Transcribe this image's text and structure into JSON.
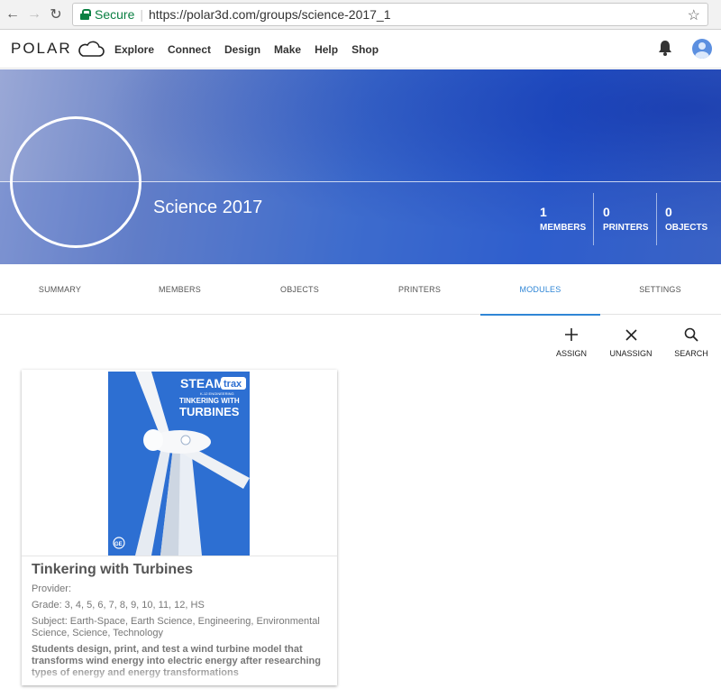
{
  "browser": {
    "secure_label": "Secure",
    "url": "https://polar3d.com/groups/science-2017_1"
  },
  "app": {
    "logo_text": "POLAR",
    "menu": [
      "Explore",
      "Connect",
      "Design",
      "Make",
      "Help",
      "Shop"
    ]
  },
  "group": {
    "title": "Science 2017",
    "stats": [
      {
        "value": "1",
        "label": "MEMBERS"
      },
      {
        "value": "0",
        "label": "PRINTERS"
      },
      {
        "value": "0",
        "label": "OBJECTS"
      }
    ]
  },
  "tabs": [
    "SUMMARY",
    "MEMBERS",
    "OBJECTS",
    "PRINTERS",
    "MODULES",
    "SETTINGS"
  ],
  "active_tab": "MODULES",
  "actions": {
    "assign": "ASSIGN",
    "unassign": "UNASSIGN",
    "search": "SEARCH"
  },
  "module": {
    "title": "Tinkering with Turbines",
    "provider": "Provider:",
    "grade": "Grade: 3, 4, 5, 6, 7, 8, 9, 10, 11, 12, HS",
    "subject": "Subject: Earth-Space, Earth Science, Engineering, Environmental Science, Science, Technology",
    "description": "Students design, print, and test a wind turbine model that transforms wind energy into electric energy after researching types of energy and energy transformations",
    "cover": {
      "brand": "STEAM",
      "brand_badge": "trax",
      "tagline": "K-12 ENGINEERING",
      "line1": "TINKERING WITH",
      "line2": "TURBINES",
      "logo": "GE"
    }
  },
  "colors": {
    "accent": "#2f86d6",
    "secure_green": "#0b8043"
  }
}
